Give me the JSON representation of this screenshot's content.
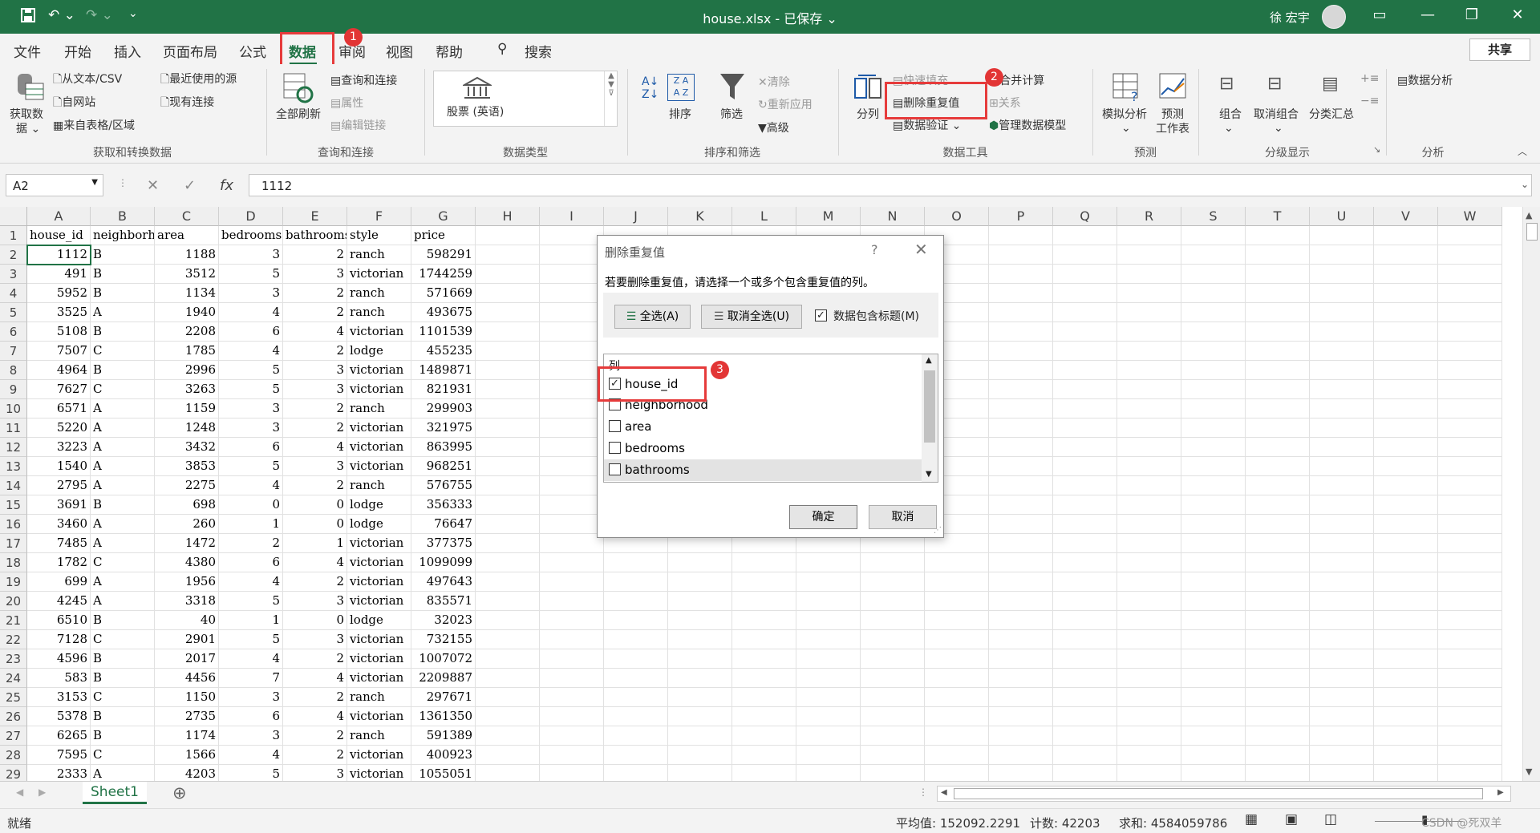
{
  "title": {
    "document": "house.xlsx - 已保存 ⌄",
    "user": "徐 宏宇"
  },
  "menu": {
    "tabs": [
      "文件",
      "开始",
      "插入",
      "页面布局",
      "公式",
      "数据",
      "审阅",
      "视图",
      "帮助"
    ],
    "search": "搜索",
    "share": "共享"
  },
  "ribbon": {
    "get_data": "获取数",
    "get_data2": "据 ⌄",
    "from_text": "从文本/CSV",
    "from_web": "自网站",
    "from_table": "来自表格/区域",
    "recent": "最近使用的源",
    "existing": "现有连接",
    "group1": "获取和转换数据",
    "refresh_all": "全部刷新",
    "query_conn": "查询和连接",
    "properties": "属性",
    "edit_links": "编辑链接",
    "group2": "查询和连接",
    "stocks": "股票 (英语)",
    "group3": "数据类型",
    "sort": "排序",
    "filter": "筛选",
    "clear": "清除",
    "reapply": "重新应用",
    "advanced": "高级",
    "group4": "排序和筛选",
    "text_to_col": "分列",
    "flash_fill": "快速填充",
    "remove_dup": "删除重复值",
    "data_valid": "数据验证",
    "consolidate": "合并计算",
    "relationships": "关系",
    "manage_model": "管理数据模型",
    "group5": "数据工具",
    "whatif": "模拟分析",
    "forecast1": "预测",
    "forecast2": "工作表",
    "group6": "预测",
    "grp": "组合",
    "ungroup": "取消组合",
    "subtotal": "分类汇总",
    "group7": "分级显示",
    "data_analysis": "数据分析",
    "group8": "分析"
  },
  "formula_bar": {
    "name_box": "A2",
    "fx": "fx",
    "value": "1112"
  },
  "columns": [
    "A",
    "B",
    "C",
    "D",
    "E",
    "F",
    "G",
    "H",
    "I",
    "J",
    "K",
    "L",
    "M",
    "N",
    "O",
    "P",
    "Q",
    "R",
    "S",
    "T",
    "U",
    "V",
    "W"
  ],
  "header_row": [
    "house_id",
    "neighborh",
    "area",
    "bedrooms",
    "bathrooms",
    "style",
    "price"
  ],
  "rows": [
    [
      "1112",
      "B",
      "1188",
      "3",
      "2",
      "ranch",
      "598291"
    ],
    [
      "491",
      "B",
      "3512",
      "5",
      "3",
      "victorian",
      "1744259"
    ],
    [
      "5952",
      "B",
      "1134",
      "3",
      "2",
      "ranch",
      "571669"
    ],
    [
      "3525",
      "A",
      "1940",
      "4",
      "2",
      "ranch",
      "493675"
    ],
    [
      "5108",
      "B",
      "2208",
      "6",
      "4",
      "victorian",
      "1101539"
    ],
    [
      "7507",
      "C",
      "1785",
      "4",
      "2",
      "lodge",
      "455235"
    ],
    [
      "4964",
      "B",
      "2996",
      "5",
      "3",
      "victorian",
      "1489871"
    ],
    [
      "7627",
      "C",
      "3263",
      "5",
      "3",
      "victorian",
      "821931"
    ],
    [
      "6571",
      "A",
      "1159",
      "3",
      "2",
      "ranch",
      "299903"
    ],
    [
      "5220",
      "A",
      "1248",
      "3",
      "2",
      "victorian",
      "321975"
    ],
    [
      "3223",
      "A",
      "3432",
      "6",
      "4",
      "victorian",
      "863995"
    ],
    [
      "1540",
      "A",
      "3853",
      "5",
      "3",
      "victorian",
      "968251"
    ],
    [
      "2795",
      "A",
      "2275",
      "4",
      "2",
      "ranch",
      "576755"
    ],
    [
      "3691",
      "B",
      "698",
      "0",
      "0",
      "lodge",
      "356333"
    ],
    [
      "3460",
      "A",
      "260",
      "1",
      "0",
      "lodge",
      "76647"
    ],
    [
      "7485",
      "A",
      "1472",
      "2",
      "1",
      "victorian",
      "377375"
    ],
    [
      "1782",
      "C",
      "4380",
      "6",
      "4",
      "victorian",
      "1099099"
    ],
    [
      "699",
      "A",
      "1956",
      "4",
      "2",
      "victorian",
      "497643"
    ],
    [
      "4245",
      "A",
      "3318",
      "5",
      "3",
      "victorian",
      "835571"
    ],
    [
      "6510",
      "B",
      "40",
      "1",
      "0",
      "lodge",
      "32023"
    ],
    [
      "7128",
      "C",
      "2901",
      "5",
      "3",
      "victorian",
      "732155"
    ],
    [
      "4596",
      "B",
      "2017",
      "4",
      "2",
      "victorian",
      "1007072"
    ],
    [
      "583",
      "B",
      "4456",
      "7",
      "4",
      "victorian",
      "2209887"
    ],
    [
      "3153",
      "C",
      "1150",
      "3",
      "2",
      "ranch",
      "297671"
    ],
    [
      "5378",
      "B",
      "2735",
      "6",
      "4",
      "victorian",
      "1361350"
    ],
    [
      "6265",
      "B",
      "1174",
      "3",
      "2",
      "ranch",
      "591389"
    ],
    [
      "7595",
      "C",
      "1566",
      "4",
      "2",
      "victorian",
      "400923"
    ],
    [
      "2333",
      "A",
      "4203",
      "5",
      "3",
      "victorian",
      "1055051"
    ]
  ],
  "sheet": {
    "name": "Sheet1",
    "add": "⊕"
  },
  "status": {
    "ready": "就绪",
    "avg": "平均值: 152092.2291",
    "count": "计数: 42203",
    "sum": "求和: 4584059786",
    "watermark": "CSDN @死双羊"
  },
  "dialog": {
    "title": "删除重复值",
    "help": "?",
    "close": "✕",
    "message": "若要删除重复值，请选择一个或多个包含重复值的列。",
    "select_all": "全选(A)",
    "unselect_all": "取消全选(U)",
    "has_headers": "数据包含标题(M)",
    "list_header": "列",
    "columns": [
      {
        "name": "house_id",
        "checked": true
      },
      {
        "name": "neighborhood",
        "checked": false
      },
      {
        "name": "area",
        "checked": false
      },
      {
        "name": "bedrooms",
        "checked": false
      },
      {
        "name": "bathrooms",
        "checked": false
      }
    ],
    "ok": "确定",
    "cancel": "取消"
  },
  "badges": [
    "1",
    "2",
    "3"
  ],
  "colors": {
    "excel_green": "#217346",
    "highlight_red": "#e63b3b"
  }
}
